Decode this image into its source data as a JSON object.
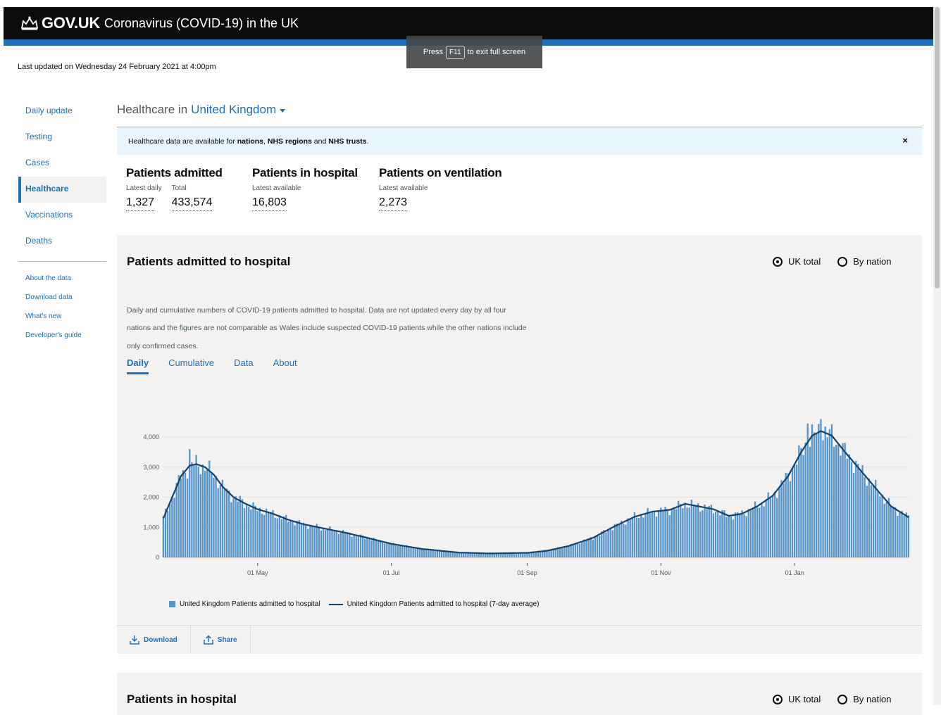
{
  "header": {
    "brand": "GOV.UK",
    "service": "Coronavirus (COVID-19) in the UK",
    "crown_icon": "crown-icon"
  },
  "fullscreen_toast": {
    "before": "Press",
    "key": "F11",
    "after": "to exit full screen"
  },
  "last_updated": "Last updated on Wednesday 24 February 2021 at 4:00pm",
  "sidebar": {
    "items": [
      {
        "label": "Daily update"
      },
      {
        "label": "Testing"
      },
      {
        "label": "Cases"
      },
      {
        "label": "Healthcare"
      },
      {
        "label": "Vaccinations"
      },
      {
        "label": "Deaths"
      }
    ],
    "sub_items": [
      {
        "label": "About the data"
      },
      {
        "label": "Download data"
      },
      {
        "label": "What's new"
      },
      {
        "label": "Developer's guide"
      }
    ]
  },
  "page": {
    "heading_prefix": "Healthcare in",
    "location": "United Kingdom"
  },
  "banner": {
    "text1": "Healthcare data are available for ",
    "b1": "nations",
    "sep1": ", ",
    "b2": "NHS regions",
    "sep2": " and ",
    "b3": "NHS trusts",
    "end": ".",
    "close": "×"
  },
  "headlines": {
    "admitted": {
      "title": "Patients admitted",
      "latest_label": "Latest daily",
      "latest": "1,327",
      "total_label": "Total",
      "total": "433,574"
    },
    "hospital": {
      "title": "Patients in hospital",
      "label": "Latest available",
      "value": "16,803"
    },
    "ventilation": {
      "title": "Patients on ventilation",
      "label": "Latest available",
      "value": "2,273"
    }
  },
  "card": {
    "title": "Patients admitted to hospital",
    "radio_uk": "UK total",
    "radio_nation": "By nation",
    "description": "Daily and cumulative numbers of COVID-19 patients admitted to hospital. Data are not updated every day by all four nations and the figures are not comparable as Wales include suspected COVID-19 patients while the other nations include only confirmed cases.",
    "tabs": [
      "Daily",
      "Cumulative",
      "Data",
      "About"
    ],
    "legend_bar": "United Kingdom Patients admitted to hospital",
    "legend_line": "United Kingdom Patients admitted to hospital (7-day average)",
    "download": "Download",
    "share": "Share"
  },
  "card2": {
    "title": "Patients in hospital",
    "radio_uk": "UK total",
    "radio_nation": "By nation"
  },
  "chart_data": {
    "type": "bar",
    "title": "Patients admitted to hospital",
    "xlabel": "",
    "ylabel": "",
    "y_ticks": [
      "0",
      "1,000",
      "2,000",
      "3,000",
      "4,000"
    ],
    "x_ticks": [
      "01 May",
      "01 Jul",
      "01 Sep",
      "01 Nov",
      "01 Jan"
    ],
    "ylim": [
      0,
      4400
    ],
    "x_range": [
      "2020-03-19",
      "2021-02-22"
    ],
    "grid": true,
    "colors": {
      "bars": "#5694ca",
      "line": "#12436d"
    },
    "series": [
      {
        "name": "United Kingdom Patients admitted to hospital (7-day average)",
        "points": [
          [
            "2020-03-19",
            1300
          ],
          [
            "2020-03-23",
            2000
          ],
          [
            "2020-03-27",
            2700
          ],
          [
            "2020-03-31",
            3050
          ],
          [
            "2020-04-03",
            3100
          ],
          [
            "2020-04-07",
            3000
          ],
          [
            "2020-04-11",
            2750
          ],
          [
            "2020-04-15",
            2350
          ],
          [
            "2020-04-20",
            2000
          ],
          [
            "2020-04-25",
            1800
          ],
          [
            "2020-05-01",
            1600
          ],
          [
            "2020-05-08",
            1450
          ],
          [
            "2020-05-15",
            1250
          ],
          [
            "2020-05-22",
            1100
          ],
          [
            "2020-06-01",
            950
          ],
          [
            "2020-06-10",
            820
          ],
          [
            "2020-06-20",
            650
          ],
          [
            "2020-07-01",
            450
          ],
          [
            "2020-07-15",
            280
          ],
          [
            "2020-08-01",
            160
          ],
          [
            "2020-08-15",
            130
          ],
          [
            "2020-09-01",
            150
          ],
          [
            "2020-09-10",
            220
          ],
          [
            "2020-09-20",
            380
          ],
          [
            "2020-10-01",
            650
          ],
          [
            "2020-10-10",
            1000
          ],
          [
            "2020-10-20",
            1350
          ],
          [
            "2020-10-28",
            1520
          ],
          [
            "2020-11-05",
            1580
          ],
          [
            "2020-11-12",
            1780
          ],
          [
            "2020-11-18",
            1700
          ],
          [
            "2020-11-25",
            1600
          ],
          [
            "2020-12-02",
            1380
          ],
          [
            "2020-12-08",
            1450
          ],
          [
            "2020-12-15",
            1700
          ],
          [
            "2020-12-22",
            2050
          ],
          [
            "2020-12-29",
            2700
          ],
          [
            "2021-01-04",
            3500
          ],
          [
            "2021-01-09",
            4050
          ],
          [
            "2021-01-13",
            4200
          ],
          [
            "2021-01-18",
            4050
          ],
          [
            "2021-01-24",
            3500
          ],
          [
            "2021-01-31",
            2900
          ],
          [
            "2021-02-07",
            2300
          ],
          [
            "2021-02-14",
            1700
          ],
          [
            "2021-02-22",
            1330
          ]
        ]
      }
    ],
    "daily_bar_note": "United Kingdom Patients admitted to hospital — daily bars follow the 7-day average with day-to-day scatter"
  }
}
